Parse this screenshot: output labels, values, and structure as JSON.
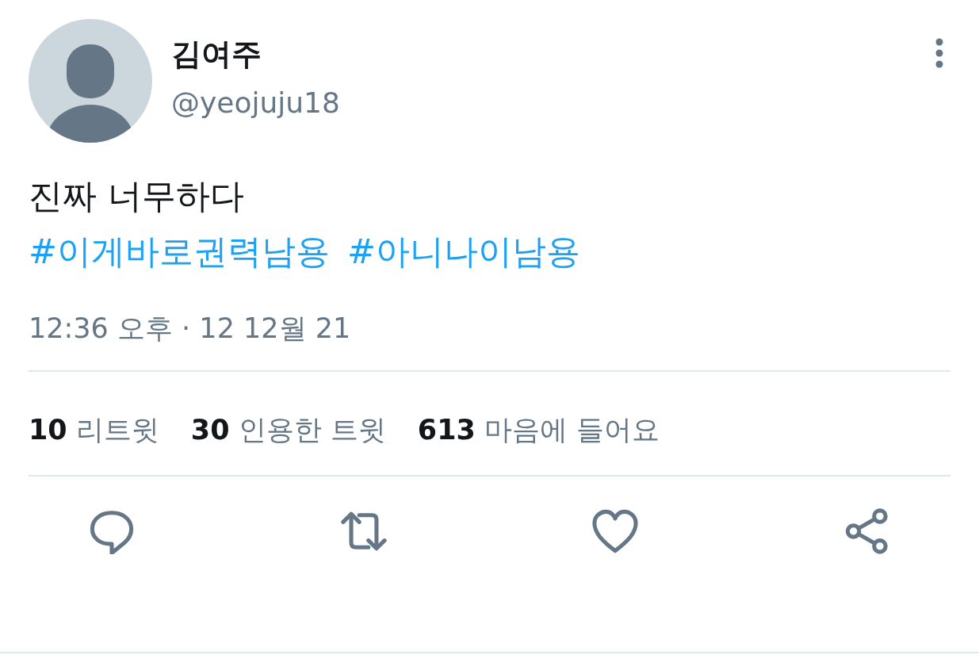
{
  "author": {
    "name": "김여주",
    "handle": "@yeojuju18"
  },
  "tweet": {
    "text": "진짜 너무하다",
    "hashtags": [
      "#이게바로권력남용",
      "#아니나이남용"
    ]
  },
  "timestamp": "12:36 오후 · 12 12월 21",
  "stats": [
    {
      "count": "10",
      "label": "리트윗"
    },
    {
      "count": "30",
      "label": "인용한 트윗"
    },
    {
      "count": "613",
      "label": "마음에 들어요"
    }
  ],
  "actions": [
    {
      "kind": "reply"
    },
    {
      "kind": "retweet"
    },
    {
      "kind": "like"
    },
    {
      "kind": "share"
    }
  ]
}
